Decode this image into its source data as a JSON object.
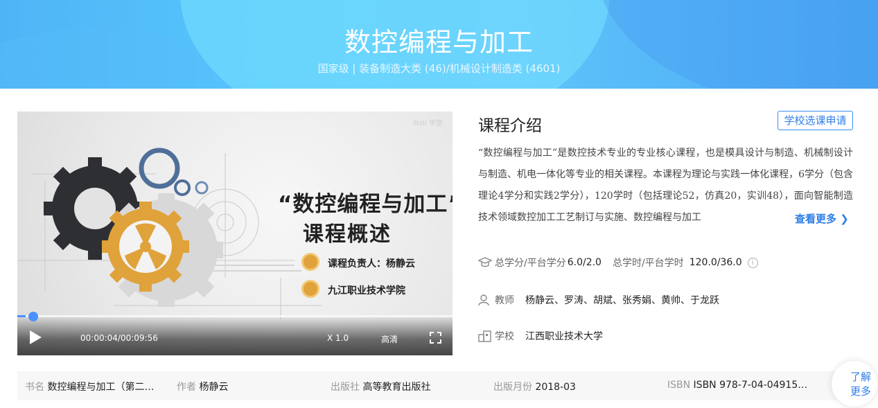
{
  "banner": {
    "title": "数控编程与加工",
    "subtitle": "国家级 | 装备制造大类 (46)/机械设计制造类 (4601)"
  },
  "video": {
    "watermark": "ilhlli 学堂",
    "cover_title_line1": "“数控编程与加工”",
    "cover_title_line2": "课程概述",
    "cover_leader": "课程负责人：杨静云",
    "cover_school": "九江职业技术学院",
    "time": "00:00:04/00:09:56",
    "speed": "X 1.0",
    "quality": "高清",
    "progress": 0.019
  },
  "intro": {
    "title": "课程介绍",
    "apply_label": "学校选课申请",
    "text": "“数控编程与加工”是数控技术专业的专业核心课程，也是模具设计与制造、机械制设计与制造、机电一体化等专业的相关课程。本课程为理论与实践一体化课程，6学分（包含理论4学分和实践2学分），120学时（包括理论52，仿真20，实训48），面向智能制造技术领域数控加工工艺制订与实施、数控编程与加工",
    "more_label": "查看更多"
  },
  "stats": {
    "credit_label": "总学分/平台学分",
    "credit_value": "6.0/2.0",
    "hours_label": "总学时/平台学时",
    "hours_value": "120.0/36.0",
    "teacher_label": "教师",
    "teacher_value": "杨静云、罗涛、胡斌、张秀娟、黄帅、于龙跃",
    "school_label": "学校",
    "school_value": "江西职业技术大学"
  },
  "book": {
    "name_label": "书名",
    "name_value": "数控编程与加工（第二…",
    "author_label": "作者",
    "author_value": "杨静云",
    "publisher_label": "出版社",
    "publisher_value": "高等教育出版社",
    "date_label": "出版月份",
    "date_value": "2018-03",
    "isbn_label": "ISBN",
    "isbn_value": "ISBN 978-7-04-04915…"
  },
  "float_more": {
    "line1": "了解",
    "line2": "更多"
  },
  "colors": {
    "accent": "#2f7ee8",
    "banner": "#56c6fb",
    "gear_gold": "#e0a23a",
    "gear_dark": "#2d2f33"
  }
}
